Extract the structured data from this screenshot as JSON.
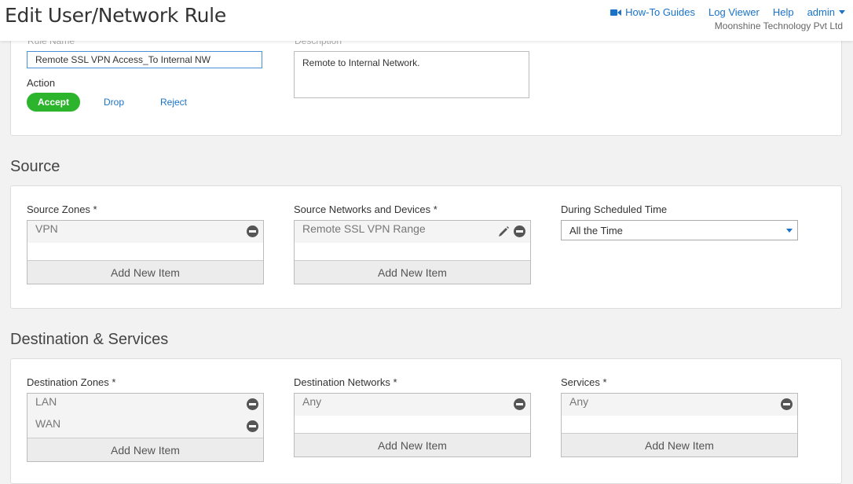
{
  "header": {
    "title": "Edit User/Network Rule",
    "links": {
      "how_to": "How-To Guides",
      "log_viewer": "Log Viewer",
      "help": "Help",
      "admin": "admin"
    },
    "company": "Moonshine Technology Pvt Ltd"
  },
  "rule": {
    "name_label": "Rule Name",
    "name_value": "Remote SSL VPN Access_To Internal NW",
    "description_label": "Description",
    "description_value": "Remote to Internal Network.",
    "action_label": "Action",
    "actions": [
      "Accept",
      "Drop",
      "Reject"
    ],
    "selected_action": "Accept"
  },
  "source": {
    "title": "Source",
    "zones_label": "Source Zones *",
    "zones": [
      "VPN"
    ],
    "networks_label": "Source Networks and Devices *",
    "networks": [
      "Remote SSL VPN Range"
    ],
    "schedule_label": "During Scheduled Time",
    "schedule_value": "All the Time",
    "add_label": "Add New Item"
  },
  "destination": {
    "title": "Destination & Services",
    "zones_label": "Destination Zones *",
    "zones": [
      "LAN",
      "WAN"
    ],
    "networks_label": "Destination Networks *",
    "networks": [
      "Any"
    ],
    "services_label": "Services *",
    "services": [
      "Any"
    ],
    "add_label": "Add New Item"
  },
  "colors": {
    "accent": "#1a73c8",
    "accept_green": "#2cb52c"
  }
}
